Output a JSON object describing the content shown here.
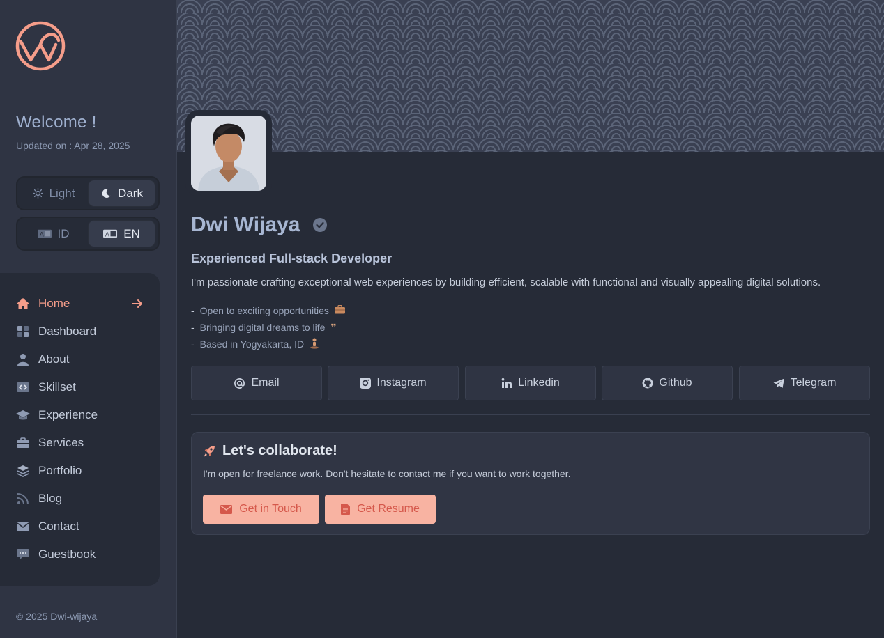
{
  "sidebar": {
    "welcome": "Welcome !",
    "updated": "Updated on : Apr 28, 2025",
    "theme": {
      "light": "Light",
      "dark": "Dark",
      "selected": "Dark"
    },
    "language": {
      "id": "ID",
      "en": "EN",
      "selected": "EN"
    },
    "nav": [
      {
        "label": "Home",
        "icon": "home-icon",
        "active": true
      },
      {
        "label": "Dashboard",
        "icon": "dashboard-icon"
      },
      {
        "label": "About",
        "icon": "user-icon"
      },
      {
        "label": "Skillset",
        "icon": "code-icon"
      },
      {
        "label": "Experience",
        "icon": "graduation-cap-icon"
      },
      {
        "label": "Services",
        "icon": "briefcase-icon"
      },
      {
        "label": "Portfolio",
        "icon": "layers-icon"
      },
      {
        "label": "Blog",
        "icon": "rss-icon"
      },
      {
        "label": "Contact",
        "icon": "envelope-icon"
      },
      {
        "label": "Guestbook",
        "icon": "chat-icon"
      }
    ],
    "copyright": "© 2025 Dwi-wijaya"
  },
  "profile": {
    "name": "Dwi Wijaya",
    "role": "Experienced Full-stack Developer",
    "intro": "I'm passionate crafting exceptional web experiences by building efficient, scalable with functional and visually appealing digital solutions.",
    "bullets": [
      {
        "text": "Open to exciting opportunities",
        "emoji": "💼"
      },
      {
        "text": "Bringing digital dreams to life",
        "emoji": "❞"
      },
      {
        "text": "Based in Yogyakarta, ID",
        "emoji": "🧍"
      }
    ]
  },
  "socials": [
    {
      "label": "Email",
      "icon": "at-icon"
    },
    {
      "label": "Instagram",
      "icon": "instagram-icon"
    },
    {
      "label": "Linkedin",
      "icon": "linkedin-icon"
    },
    {
      "label": "Github",
      "icon": "github-icon"
    },
    {
      "label": "Telegram",
      "icon": "telegram-icon"
    }
  ],
  "collab": {
    "title": "Let's collaborate!",
    "text": "I'm open for freelance work. Don't hesitate to contact me if you want to work together.",
    "touch_label": "Get in Touch",
    "resume_label": "Get Resume"
  },
  "colors": {
    "accent": "#f59d8a",
    "button_bg": "#f8b3a2",
    "button_text": "#d5584b",
    "sidebar_bg": "#2f3443",
    "main_bg": "#262b37"
  }
}
